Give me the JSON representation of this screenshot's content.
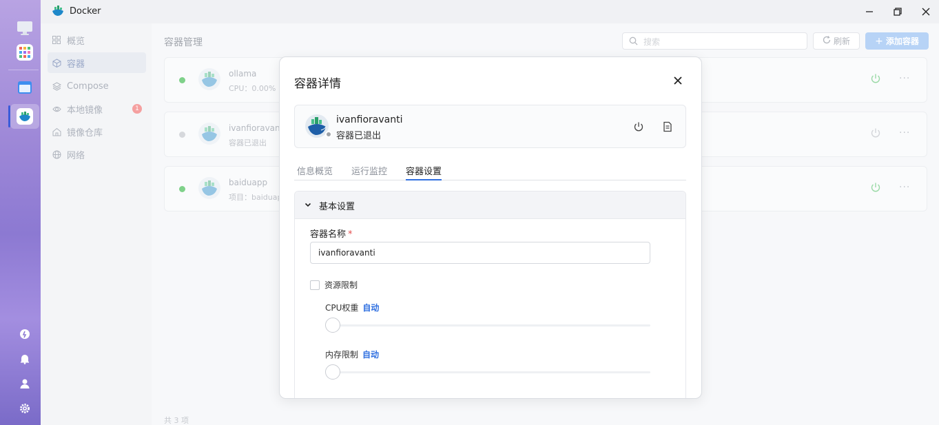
{
  "window": {
    "title": "Docker"
  },
  "sidebar": {
    "items": [
      {
        "label": "概览"
      },
      {
        "label": "容器"
      },
      {
        "label": "Compose"
      },
      {
        "label": "本地镜像",
        "badge": "1"
      },
      {
        "label": "镜像仓库"
      },
      {
        "label": "网络"
      }
    ]
  },
  "main": {
    "title": "容器管理",
    "search_placeholder": "搜索",
    "refresh_label": "刷新",
    "add_label": "添加容器",
    "footer": "共 3 项",
    "containers": [
      {
        "name": "ollama",
        "sub": "CPU：0.00%",
        "status_color": "#7fd18a"
      },
      {
        "name": "ivanfioravanti",
        "sub": "容器已退出",
        "status_color": "#d6d8dc"
      },
      {
        "name": "baiduapp",
        "sub": "项目：baiduap",
        "status_color": "#7fd18a"
      }
    ]
  },
  "modal": {
    "title": "容器详情",
    "container_name": "ivanfioravanti",
    "container_status": "容器已退出",
    "tabs": [
      {
        "label": "信息概览"
      },
      {
        "label": "运行监控"
      },
      {
        "label": "容器设置"
      }
    ],
    "active_tab": "容器设置",
    "section_title": "基本设置",
    "name_label": "容器名称",
    "required_mark": "*",
    "name_value": "ivanfioravanti",
    "resource_limit_label": "资源限制",
    "resource_limit_checked": false,
    "cpu_label": "CPU权重",
    "cpu_value": "自动",
    "memory_label": "内存限制",
    "memory_value": "自动"
  },
  "colors": {
    "accent": "#2f6fe0",
    "add_button": "#b7d3f6",
    "running": "#7fd18a",
    "stopped": "#9ea2a8"
  }
}
